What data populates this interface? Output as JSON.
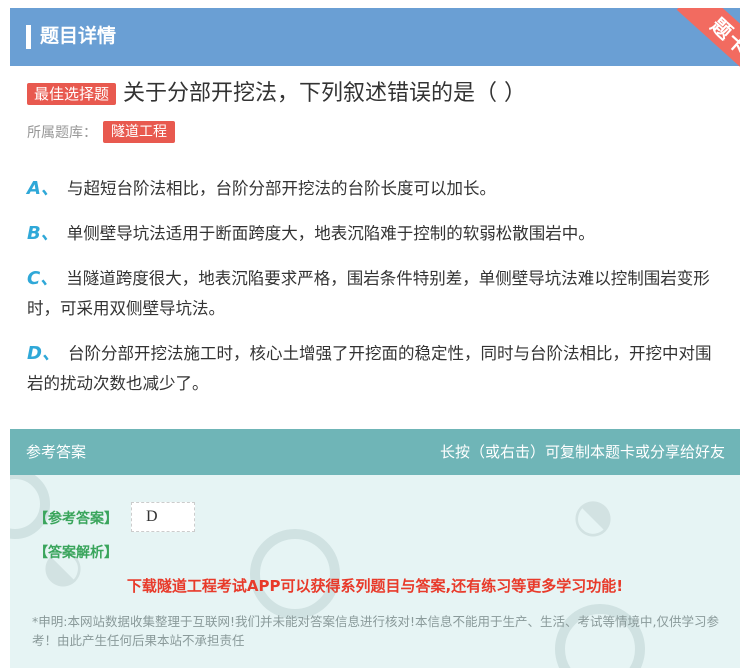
{
  "header": {
    "title": "题目详情",
    "ribbon_text": "题卡"
  },
  "question": {
    "type_tag": "最佳选择题",
    "text": "关于分部开挖法，下列叙述错误的是（  ）",
    "library_label": "所属题库：",
    "library_name": "隧道工程"
  },
  "options": [
    {
      "letter": "A、",
      "text": "与超短台阶法相比，台阶分部开挖法的台阶长度可以加长。"
    },
    {
      "letter": "B、",
      "text": "单侧壁导坑法适用于断面跨度大，地表沉陷难于控制的软弱松散围岩中。"
    },
    {
      "letter": "C、",
      "text": "当隧道跨度很大，地表沉陷要求严格，围岩条件特别差，单侧壁导坑法难以控制围岩变形时，可采用双侧壁导坑法。"
    },
    {
      "letter": "D、",
      "text": "台阶分部开挖法施工时，核心土增强了开挖面的稳定性，同时与台阶法相比，开挖中对围岩的扰动次数也减少了。"
    }
  ],
  "answer": {
    "head_left": "参考答案",
    "head_right": "长按（或右击）可复制本题卡或分享给好友",
    "ref_label": "【参考答案】",
    "ref_value": "D",
    "analysis_label": "【答案解析】",
    "promo": "下载隧道工程考试APP可以获得系列题目与答案,还有练习等更多学习功能!",
    "disclaimer": "*申明:本网站数据收集整理于互联网!我们并未能对答案信息进行核对!本信息不能用于生产、生活、考试等情境中,仅供学习参考！由此产生任何后果本站不承担责任"
  },
  "colors": {
    "header_bg": "#6a9fd4",
    "ribbon": "#f26b60",
    "tag_red": "#e8594f",
    "option_letter": "#2fa8d8",
    "answer_head": "#6fb5b7",
    "answer_bg": "#e6f4f4",
    "answer_label": "#3aa55c",
    "promo": "#e83a2a"
  }
}
